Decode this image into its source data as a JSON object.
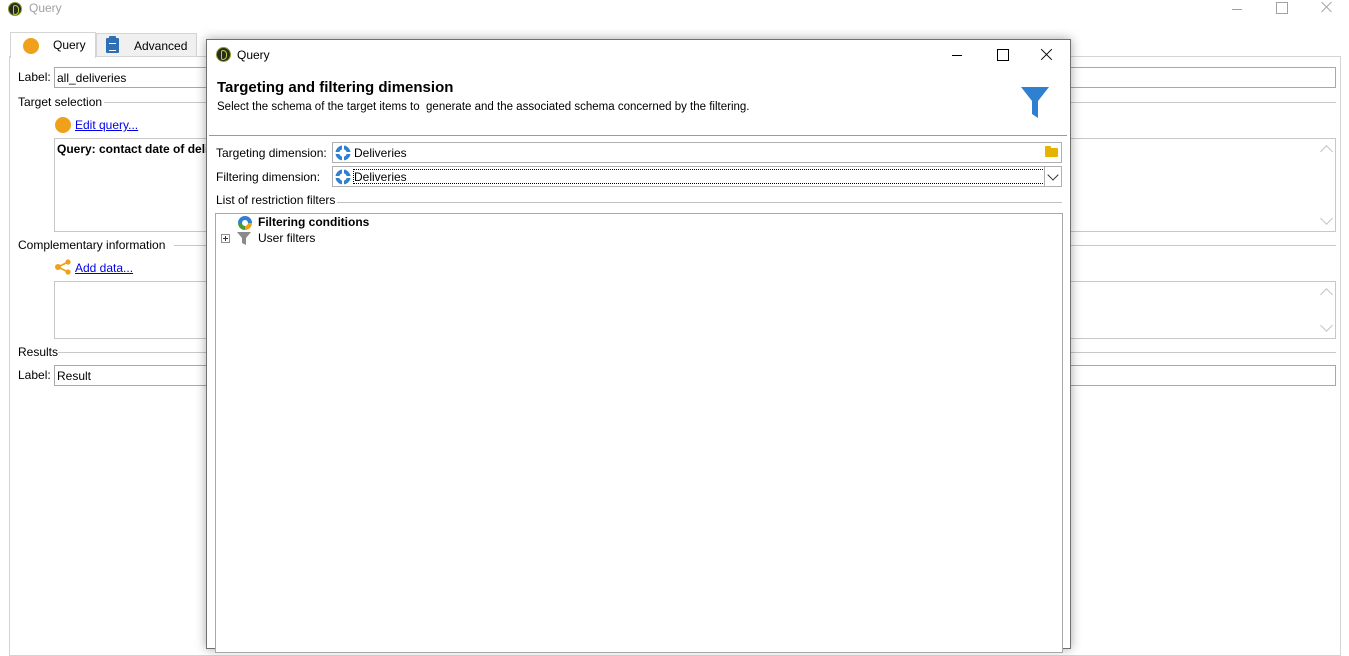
{
  "background_window": {
    "title": "Query",
    "tabs": [
      {
        "label": "Query"
      },
      {
        "label": "Advanced"
      }
    ],
    "label_caption": "Label:",
    "label_value": "all_deliveries",
    "target_selection": {
      "heading": "Target selection",
      "edit_link": "Edit query...",
      "query_text": "Query: contact date of deli"
    },
    "complementary": {
      "heading": "Complementary information",
      "add_link": "Add data..."
    },
    "results": {
      "heading": "Results",
      "label_caption": "Label:",
      "label_value": "Result"
    }
  },
  "dialog": {
    "title": "Query",
    "heading": "Targeting and filtering dimension",
    "subtitle": "Select the schema of the target items to  generate and the associated schema concerned by the filtering.",
    "targeting_label": "Targeting dimension:",
    "targeting_value": "Deliveries",
    "filtering_label": "Filtering dimension:",
    "filtering_value": "Deliveries",
    "filters_section": "List of restriction filters",
    "tree": [
      {
        "label": "Filtering conditions",
        "bold": true
      },
      {
        "label": "User filters",
        "bold": false
      }
    ]
  },
  "icons": {
    "app": "adobe-campaign-icon",
    "funnel": "funnel-icon",
    "schema": "schema-icon",
    "folder": "folder-icon",
    "share": "share-icon",
    "clipboard": "clipboard-icon"
  },
  "colors": {
    "accent_orange": "#f0a11c",
    "link_blue": "#0000e6",
    "funnel_blue": "#2f80d1",
    "folder_yellow": "#e6b400"
  }
}
